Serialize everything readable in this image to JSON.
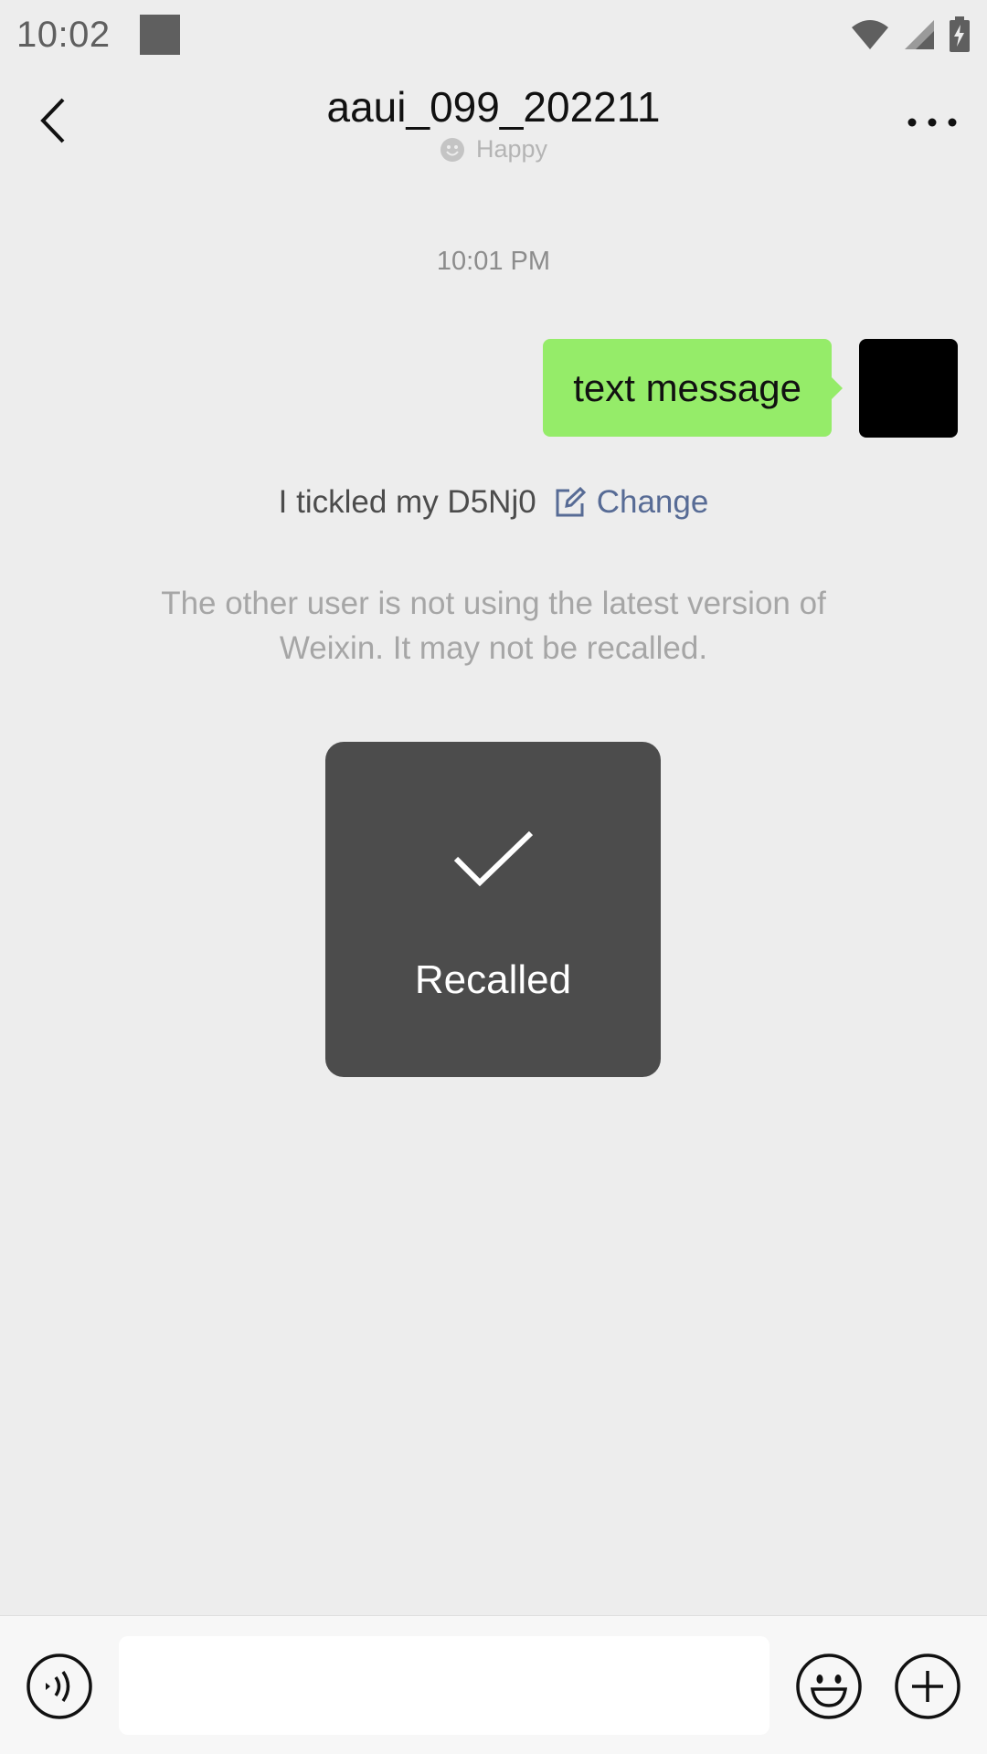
{
  "status_bar": {
    "time": "10:02",
    "icons": [
      "wifi-icon",
      "signal-icon",
      "battery-charging-icon"
    ]
  },
  "header": {
    "title": "aaui_099_202211",
    "status_text": "Happy",
    "status_icon": "smiley-status-icon",
    "back_icon": "chevron-left-icon",
    "more_icon": "more-dots-icon"
  },
  "chat": {
    "timestamp": "10:01 PM",
    "messages": [
      {
        "text": "text message",
        "sender": "self"
      }
    ],
    "tickle": {
      "text": "I  tickled my D5Nj0",
      "change_label": "Change"
    },
    "notice": "The other user is not using the latest version of Weixin. It may not be recalled."
  },
  "toast": {
    "label": "Recalled",
    "icon": "checkmark-icon"
  },
  "input_bar": {
    "value": "",
    "placeholder": ""
  },
  "colors": {
    "background": "#ededed",
    "bubble_self": "#95ec69",
    "link": "#576b95",
    "toast_bg": "#4c4c4c"
  }
}
